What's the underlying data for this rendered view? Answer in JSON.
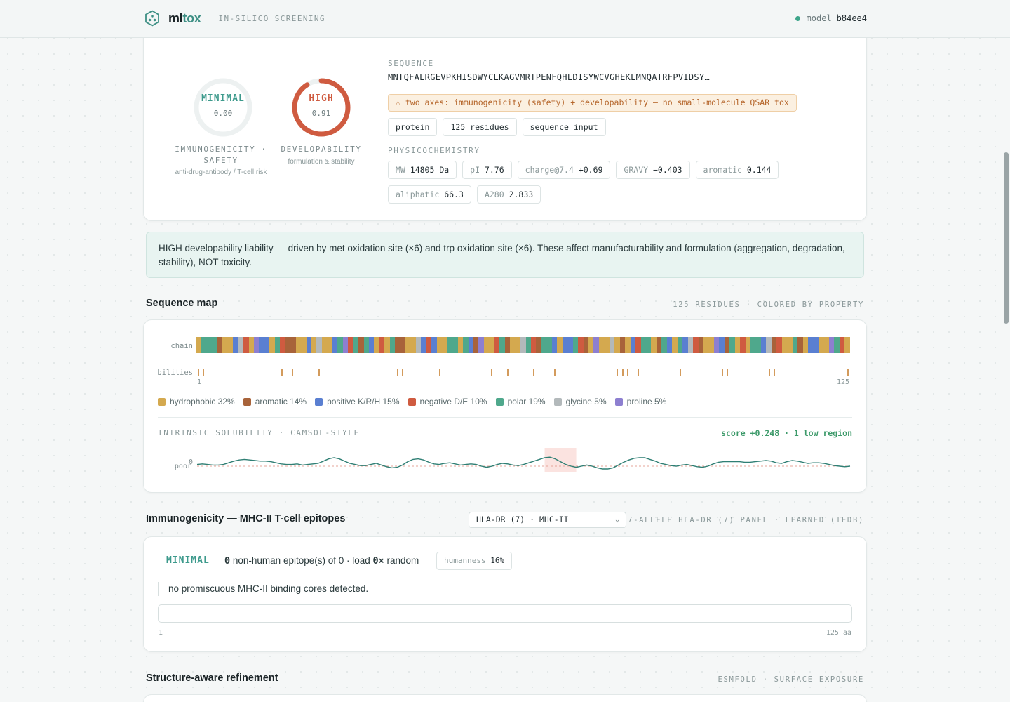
{
  "header": {
    "brand_prefix": "ml",
    "brand_suffix": "tox",
    "subtitle": "IN-SILICO SCREENING",
    "model_label": "model",
    "model_id": "b84ee4"
  },
  "scores": {
    "immunogenicity": {
      "level": "MINIMAL",
      "value": "0.00",
      "fraction": 0.0,
      "title": "IMMUNOGENICITY · SAFETY",
      "subtitle": "anti-drug-antibody / T-cell risk",
      "color": "#3d9a8c"
    },
    "developability": {
      "level": "HIGH",
      "value": "0.91",
      "fraction": 0.91,
      "title": "DEVELOPABILITY",
      "subtitle": "formulation & stability",
      "color": "#cf5b40"
    }
  },
  "sequence": {
    "label": "SEQUENCE",
    "text": "MNTQFALRGEVPKHISDWYCLKAGVMRTPENFQHLDISYWCVGHEKLMNQATRFPVIDSY…",
    "warning": "⚠ two axes: immunogenicity (safety) + developability — no small-molecule QSAR tox",
    "chips": [
      "protein",
      "125 residues",
      "sequence input"
    ]
  },
  "physchem": {
    "label": "PHYSICOCHEMISTRY",
    "items": [
      {
        "k": "MW",
        "v": "14805 Da"
      },
      {
        "k": "pI",
        "v": "7.76"
      },
      {
        "k": "charge@7.4",
        "v": "+0.69"
      },
      {
        "k": "GRAVY",
        "v": "−0.403"
      },
      {
        "k": "aromatic",
        "v": "0.144"
      },
      {
        "k": "aliphatic",
        "v": "66.3"
      },
      {
        "k": "A280",
        "v": "2.833"
      }
    ]
  },
  "callout": "HIGH developability liability — driven by met oxidation site (×6) and trp oxidation site (×6). These affect manufacturability and formulation (aggregation, degradation, stability), NOT toxicity.",
  "seqmap": {
    "title": "Sequence map",
    "meta": "125 RESIDUES · COLORED BY PROPERTY",
    "row_chain": "chain",
    "row_liabilities": "liabilities",
    "start": "1",
    "end": "125",
    "residues": "MNTQFALRGEVPKHISDWYCLKAGVMRTPENFQHLDISYWCVGHEKLMNQATRFPVIDSYLAGNEWTSKVRHQDFLPAMGCYIKENTVWSRLQHGDFAMPKYTLEVSNRGWDIAQFCKHMLPTEV",
    "liability_positions": [
      1,
      2,
      17,
      19,
      24,
      39,
      40,
      47,
      57,
      60,
      65,
      69,
      81,
      82,
      83,
      85,
      93,
      101,
      102,
      110,
      111,
      125
    ],
    "legend": [
      {
        "name": "hydrophobic",
        "pct": "32%",
        "color": "#d4a94f"
      },
      {
        "name": "aromatic",
        "pct": "14%",
        "color": "#a8633a"
      },
      {
        "name": "positive K/R/H",
        "pct": "15%",
        "color": "#5a7fd1"
      },
      {
        "name": "negative D/E",
        "pct": "10%",
        "color": "#cf5b40"
      },
      {
        "name": "polar",
        "pct": "19%",
        "color": "#4fa88c"
      },
      {
        "name": "glycine",
        "pct": "5%",
        "color": "#b3b9bb"
      },
      {
        "name": "proline",
        "pct": "5%",
        "color": "#8d7fd0"
      }
    ],
    "solubility": {
      "label": "INTRINSIC SOLUBILITY · CAMSOL-STYLE",
      "score": "score +0.248 · 1 low region",
      "zero_label": "0",
      "poor_label": "poor",
      "profile": [
        0.3,
        0.4,
        0.3,
        0.2,
        0.2,
        0.3,
        0.6,
        0.9,
        1.1,
        1.2,
        1.1,
        1.0,
        0.9,
        0.9,
        0.8,
        0.6,
        0.4,
        0.3,
        0.3,
        0.4,
        0.2,
        0.3,
        0.4,
        0.5,
        0.9,
        1.3,
        1.5,
        1.3,
        0.9,
        0.5,
        0.3,
        0.1,
        0.1,
        0.3,
        0.5,
        0.2,
        -0.1,
        -0.3,
        -0.2,
        0.2,
        0.8,
        1.2,
        1.3,
        1.1,
        0.7,
        0.4,
        0.3,
        0.5,
        0.6,
        0.4,
        0.2,
        0.3,
        0.4,
        0.3,
        0.0,
        -0.2,
        0.0,
        0.3,
        0.5,
        0.4,
        0.2,
        0.1,
        0.3,
        0.6,
        0.9,
        1.2,
        1.5,
        1.6,
        1.3,
        0.8,
        0.3,
        0.0,
        -0.2,
        0.0,
        0.2,
        0.0,
        -0.3,
        -0.5,
        -0.5,
        -0.3,
        0.2,
        0.7,
        1.1,
        1.4,
        1.5,
        1.5,
        1.2,
        0.9,
        0.5,
        0.3,
        0.1,
        0.0,
        0.2,
        0.3,
        0.1,
        -0.1,
        -0.2,
        0.0,
        0.4,
        0.7,
        0.8,
        0.8,
        0.8,
        0.8,
        0.7,
        0.7,
        0.8,
        0.9,
        1.0,
        0.9,
        0.6,
        0.5,
        0.8,
        1.0,
        0.9,
        0.7,
        0.5,
        0.6,
        0.6,
        0.5,
        0.3,
        0.1,
        0.0,
        -0.1,
        0.0
      ],
      "low_region": [
        67,
        73
      ]
    }
  },
  "immuno": {
    "title": "Immunogenicity — MHC-II T-cell epitopes",
    "panel_select": "HLA-DR (7) · MHC-II",
    "meta": "7-ALLELE HLA-DR (7) PANEL · LEARNED (IEDB)",
    "level": "MINIMAL",
    "count": "0",
    "text_mid": " non-human epitope(s) of 0 · load ",
    "load": "0×",
    "text_end": " random",
    "humanness_label": "humanness",
    "humanness_value": "16%",
    "note": "no promiscuous MHC-II binding cores detected.",
    "track_start": "1",
    "track_end": "125 aa"
  },
  "structure": {
    "title": "Structure-aware refinement",
    "meta": "ESMFOLD · SURFACE EXPOSURE"
  }
}
